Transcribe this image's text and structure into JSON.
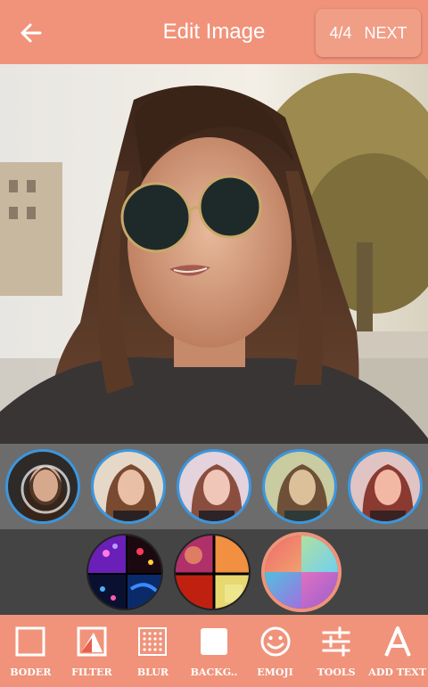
{
  "header": {
    "title": "Edit Image",
    "page_counter": "4/4",
    "next_label": "NEXT"
  },
  "colors": {
    "accent": "#f0937a",
    "thumb_border": "#3a97e0"
  },
  "filters": [
    {
      "name": "filter-original-selected"
    },
    {
      "name": "filter-warm"
    },
    {
      "name": "filter-soft"
    },
    {
      "name": "filter-vintage"
    },
    {
      "name": "filter-vivid"
    }
  ],
  "backgrounds": [
    {
      "name": "background-hearts"
    },
    {
      "name": "background-stained-glass"
    },
    {
      "name": "background-gradient"
    }
  ],
  "tools": [
    {
      "label": "BODER",
      "icon": "border-square-icon"
    },
    {
      "label": "FILTER",
      "icon": "filter-image-icon"
    },
    {
      "label": "BLUR",
      "icon": "blur-grid-icon"
    },
    {
      "label": "BACKG..",
      "icon": "background-square-icon"
    },
    {
      "label": "EMOJI",
      "icon": "emoji-smile-icon"
    },
    {
      "label": "TOOLS",
      "icon": "tools-sliders-icon"
    },
    {
      "label": "ADD TEXT",
      "icon": "text-a-icon"
    }
  ]
}
